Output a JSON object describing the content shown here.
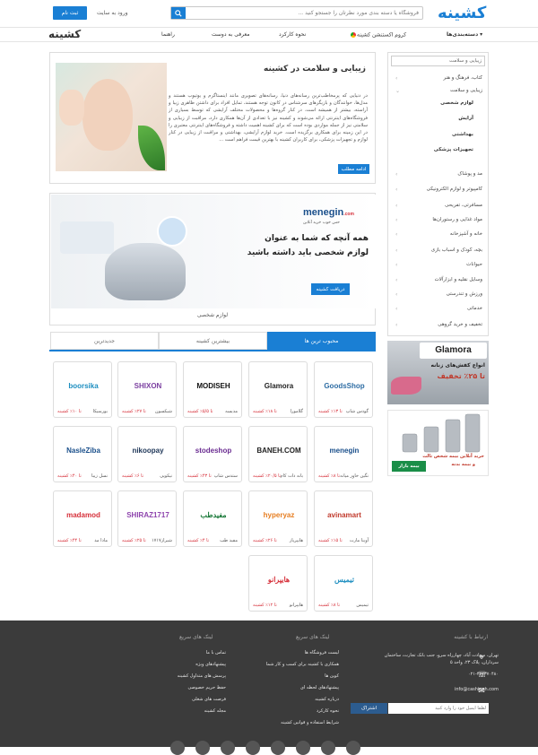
{
  "header": {
    "logo": "کشینه",
    "search_placeholder": "فروشگاه یا دسته بندی مورد نظرتان را جستجو کنید ...",
    "register": "ثبت نام",
    "login": "ورود به سایت"
  },
  "nav": {
    "categories": "دسته‌بندی‌ها",
    "extension": "کروم اکستنشن کشینه",
    "how": "نحوه کارکرد",
    "invite": "معرفی به دوست",
    "guide": "راهنما",
    "logo": "کشینه"
  },
  "sidebar": {
    "search": "زیبایی و سلامت",
    "items": [
      "کتاب، فرهنگ و هنر",
      "زیبایی و سلامت",
      "لوازم شخصی",
      "آرایش",
      "بهداشتی",
      "تجهیزات پزشکی",
      "مد و پوشاک",
      "کامپیوتر و لوازم الکترونیکی",
      "مسافرتی، تفریحی",
      "مواد غذایی و رستوران‌ها",
      "خانه و آشپزخانه",
      "بچه، کودک و اسباب بازی",
      "حیوانات",
      "وسایل نقلیه و ابزارآلات",
      "ورزش و تندرستی",
      "خدماتی",
      "تخفیف و خرید گروهی"
    ]
  },
  "banners": {
    "glamora_title": "Glamora",
    "glamora_line1": "انواع کفش‌های زنانه",
    "glamora_line2": "تا ۲۵٪ تخفیف",
    "bimebazar_line1": "خرید آنلاین بیمه شخص ثالث",
    "bimebazar_line2": "و بیمه بدنه",
    "bimebazar_brand": "بیمه بازار"
  },
  "article": {
    "title": "زیبایی و سلامت در کشینه",
    "body": "در دنیایی که پرمخاطب‌ترین رسانه‌های دنیا، رسانه‌های تصویری مانند اینستاگرم و یوتیوب هستند و مدل‌ها، خوانندگان و بازیگرهای سرشناس در کانون توجه هستند، تمایل افراد برای داشتن ظاهری زیبا و آراسته، بیشتر از همیشه است. در کنار گروه‌ها و محصولات مختلف آرایشی که توسط بسیاری از فروشگاه‌های اینترنتی ارائه می‌شوند و کشینه نیز با تعدادی از آن‌ها همکاری دارد، مراقبت از زیبایی و سلامتی نیز از جمله مواردی بوده است که برای کشینه اهمیت داشته و فروشگاه‌های اینترنتی معتبری را در این زمینه برای همکاری برگزیده است. خرید لوازم آرایشی، بهداشتی و مراقبت از زیبایی در کنار لوازم و تجهیزات پزشکی، برای کاربران کشینه با بهترین قیمت فراهم است ...",
    "more": "ادامه مطلب"
  },
  "promo": {
    "brand": "menegin",
    "brand_sub": ".com",
    "tagline": "حس خوب خرید آنلاین",
    "headline1": "همه آنچه که شما به عنوان",
    "headline2": "لوازم شخصی باید داشته باشید",
    "cta": "دریافت کشینه",
    "caption": "لوازم شخصی"
  },
  "tabs": [
    "محبوب ترین ها",
    "بیشترین کشینه",
    "جدیدترین"
  ],
  "stores": [
    {
      "logo": "GoodsShop",
      "name": "گودس شاپ",
      "cash": "تا ۱۳٪ کشینه",
      "color": "#2e6da4"
    },
    {
      "logo": "Glamora",
      "name": "گلامورا",
      "cash": "تا ۱۸٪ کشینه",
      "color": "#222222"
    },
    {
      "logo": "MODISEH",
      "name": "مدیسه",
      "cash": "تا ۵/۵٪ کشینه",
      "color": "#111111"
    },
    {
      "logo": "SHIXON",
      "name": "شیکسون",
      "cash": "تا ۲۷٪ کشینه",
      "color": "#7b3fa0"
    },
    {
      "logo": "boorsika",
      "name": "بورسیکا",
      "cash": "تا ۱۰٪ کشینه",
      "color": "#1d8ec0"
    },
    {
      "logo": "menegin",
      "name": "نگین خاور میانه",
      "cash": "تا ۸٪ کشینه",
      "color": "#1a4f8b"
    },
    {
      "logo": "BANEH.COM",
      "name": "بانه دات کام",
      "cash": "تا ۲۰/۵٪ کشینه",
      "color": "#222222"
    },
    {
      "logo": "stodeshop",
      "name": "ستدس شاپ",
      "cash": "تا ۴۳٪ کشینه",
      "color": "#6a2c91"
    },
    {
      "logo": "nikoopay",
      "name": "نیکوپی",
      "cash": "تا ۶٪ کشینه",
      "color": "#1d3557"
    },
    {
      "logo": "NasleZiba",
      "name": "نسل زیبا",
      "cash": "تا ۴۰٪ کشینه",
      "color": "#1a4f8b"
    },
    {
      "logo": "avinamart",
      "name": "آوینا مارت",
      "cash": "تا ۱۵٪ کشینه",
      "color": "#c0392b"
    },
    {
      "logo": "hyperyaz",
      "name": "هایپریاز",
      "cash": "تا ۲۶٪ کشینه",
      "color": "#e67e22"
    },
    {
      "logo": "مفیدطب",
      "name": "مفید طب",
      "cash": "تا ۴٪ کشینه",
      "color": "#1b7a3a"
    },
    {
      "logo": "SHIRAZ1717",
      "name": "شیراز۱۷۱۷",
      "cash": "تا ۲۵٪ کشینه",
      "color": "#8e44ad"
    },
    {
      "logo": "madamod",
      "name": "مادا مد",
      "cash": "تا ۴۴٪ کشینه",
      "color": "#d6303a"
    },
    {
      "logo": "تیمیس",
      "name": "تیمیس",
      "cash": "تا ۸٪ کشینه",
      "color": "#1d8ec0"
    },
    {
      "logo": "هایپرانو",
      "name": "هایپرانو",
      "cash": "تا ۱۲٪ کشینه",
      "color": "#d6303a"
    }
  ],
  "footer": {
    "contact_title": "ارتباط با کشینه",
    "address": "تهران، سعادت آباد، چهارراه سرو، جنب بانک تجارت، ساختمان سرداران، پلاک ۲۳، واحد ۵",
    "phone": "۰۲۱-۲۲۳۳۷۰۴۸۰",
    "email": "info@cashineh.com",
    "newsletter_placeholder": "لطفا ایمیل خود را وارد کنید",
    "subscribe": "اشتراک",
    "links1_title": "لینک های سریع",
    "links1": [
      "لیست فروشگاه ها",
      "همکاری با کشینه برای کسب و کار شما",
      "کوپن ها",
      "پیشنهادهای لحظه ای",
      "درباره کشینه",
      "نحوه کارکرد",
      "شرایط استفاده و قوانین کشینه"
    ],
    "links2_title": "لینک های سریع",
    "links2": [
      "تماس با ما",
      "پیشنهادهای ویژه",
      "پرسش های متداول کشینه",
      "حفظ حریم خصوصی",
      "فرصت های شغلی",
      "مجله کشینه"
    ]
  }
}
